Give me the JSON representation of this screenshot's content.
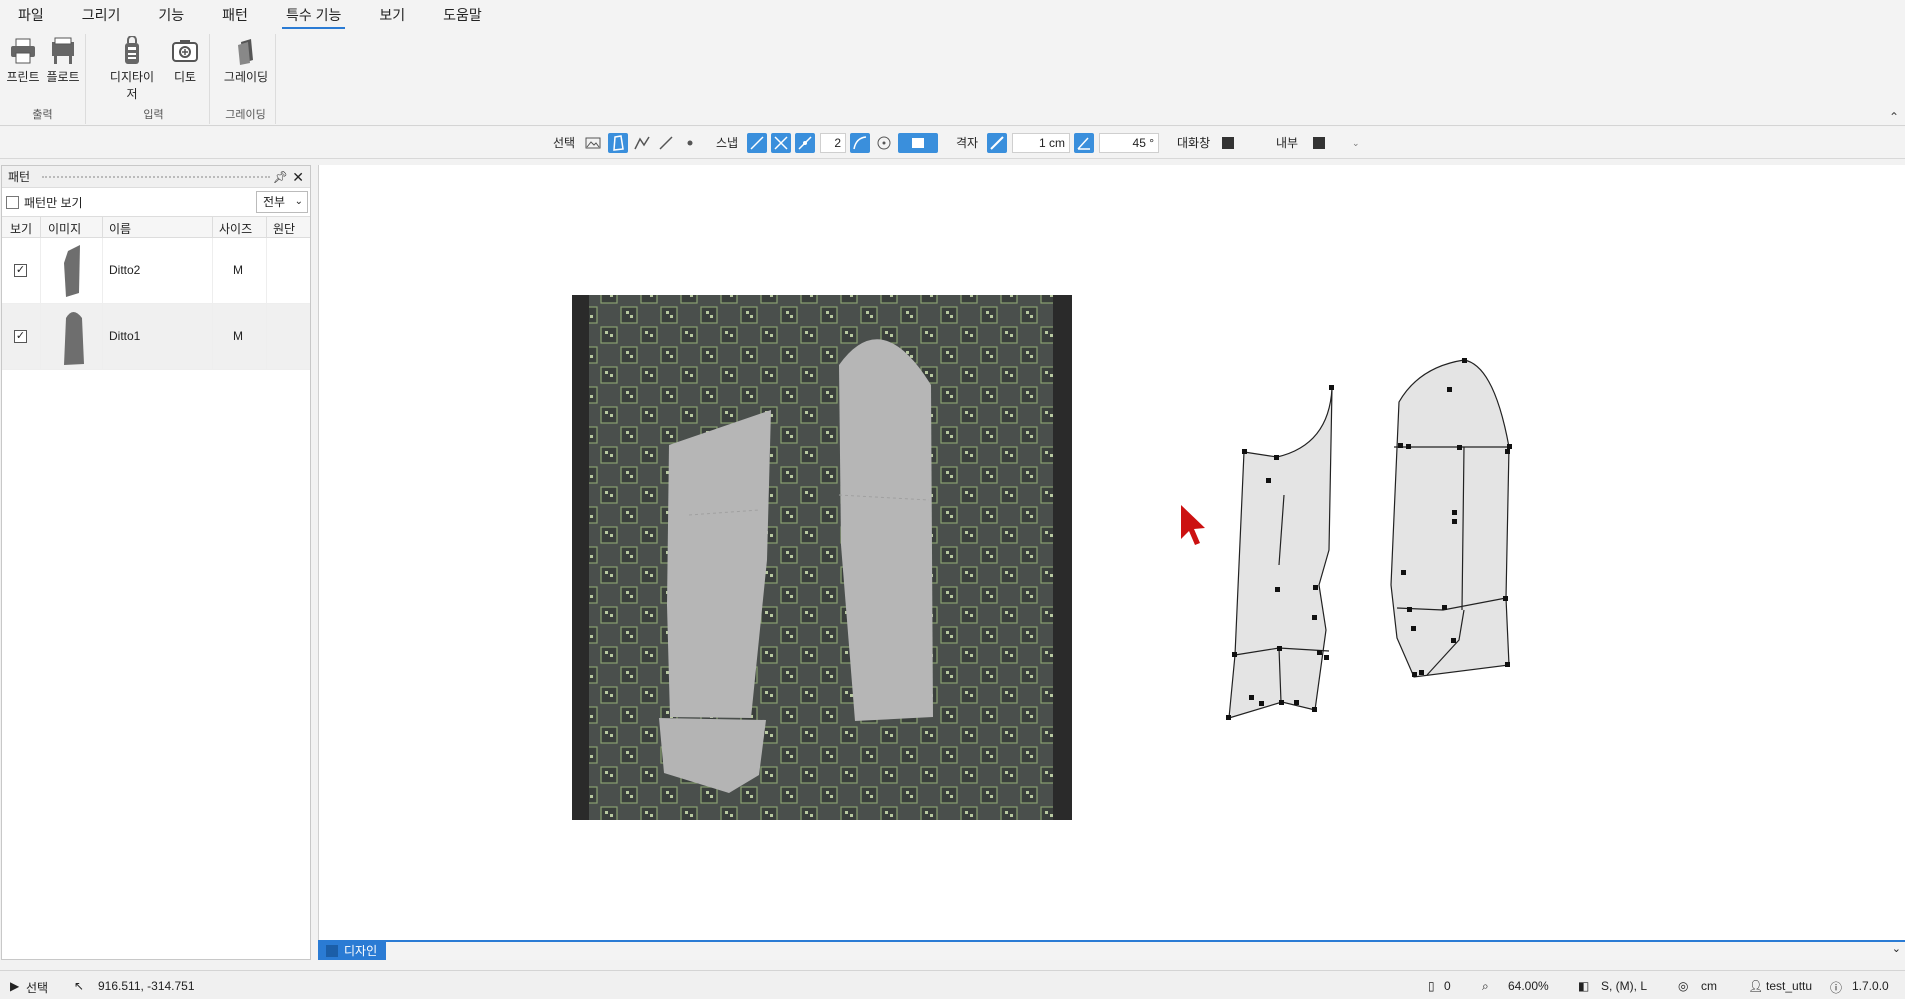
{
  "menu": [
    "파일",
    "그리기",
    "기능",
    "패턴",
    "특수 기능",
    "보기",
    "도움말"
  ],
  "menu_active": "특수 기능",
  "ribbon": {
    "print": "프린트",
    "plot": "플로트",
    "digitizer": "디지타이저",
    "ditto": "디토",
    "grading": "그레이딩",
    "group_output": "출력",
    "group_input": "입력",
    "group_grading": "그레이딩"
  },
  "toolbar": {
    "select_label": "선택",
    "snap_label": "스냅",
    "snap_value": "2",
    "grid_label": "격자",
    "grid_value": "1 cm",
    "angle_value": "45 °",
    "dialog_label": "대화창",
    "inner_label": "내부"
  },
  "panel": {
    "title": "패턴",
    "pattern_only": "패턴만 보기",
    "filter": "전부",
    "columns": [
      "보기",
      "이미지",
      "이름",
      "사이즈",
      "원단"
    ],
    "rows": [
      {
        "name": "Ditto2",
        "size": "M",
        "checked": "✓"
      },
      {
        "name": "Ditto1",
        "size": "M",
        "checked": "✓"
      }
    ]
  },
  "tab": {
    "label": "디자인"
  },
  "status": {
    "mode": "선택",
    "coords": "916.511, -314.751",
    "pieces": "0",
    "zoom": "64.00%",
    "sizes": "S, (M), L",
    "unit": "cm",
    "user": "test_uttu",
    "version": "1.7.0.0"
  },
  "colors": {
    "accent": "#2a7bd4",
    "cursor": "#cc1111",
    "mat": "#4a4f4c"
  }
}
